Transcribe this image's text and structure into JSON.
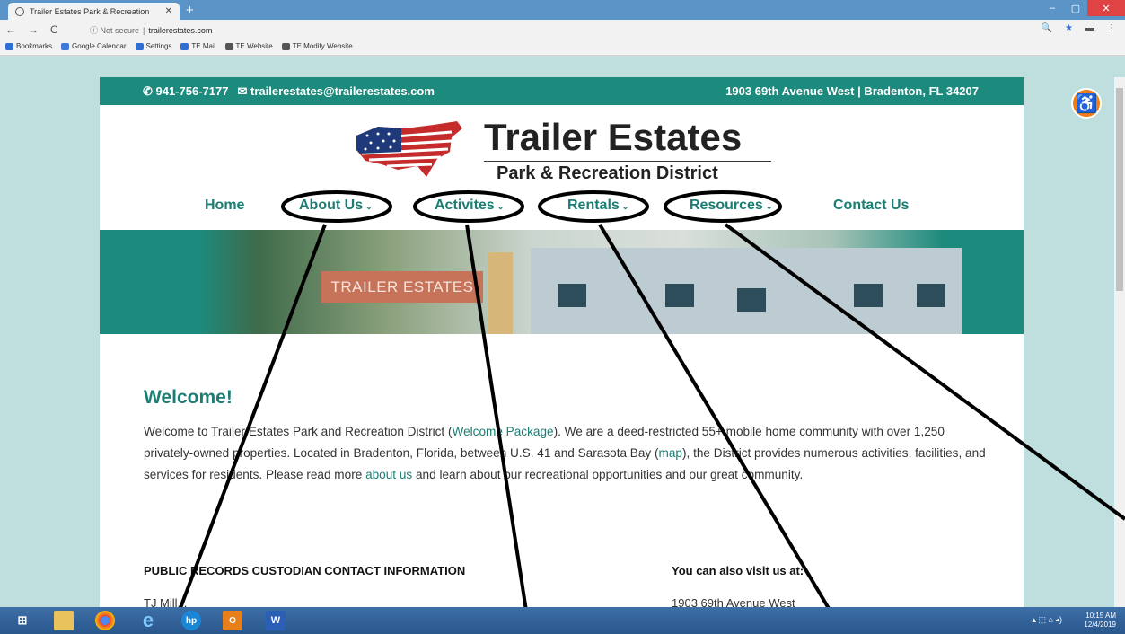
{
  "browser": {
    "tab_title": "Trailer Estates Park & Recreation",
    "tab_close": "✕",
    "new_tab": "+",
    "win_controls": [
      "–",
      "▢",
      "✕"
    ],
    "nav": [
      "←",
      "→",
      "C"
    ],
    "security": "ⓘ Not secure",
    "separator": "|",
    "url": "trailerestates.com",
    "right_icons": [
      "🔍",
      "★",
      "▬",
      "⋮"
    ],
    "bookmarks": [
      {
        "label": "Bookmarks",
        "icon": "star-icon",
        "color": "#2f6fd4"
      },
      {
        "label": "Google Calendar",
        "icon": "calendar-icon",
        "color": "#3f78d8"
      },
      {
        "label": "Settings",
        "icon": "gear-icon",
        "color": "#2f6fd4"
      },
      {
        "label": "TE Mail",
        "icon": "mail-icon",
        "color": "#2f6fd4"
      },
      {
        "label": "TE Website",
        "icon": "globe-icon",
        "color": "#555555"
      },
      {
        "label": "TE Modify Website",
        "icon": "globe-icon",
        "color": "#555555"
      }
    ]
  },
  "site": {
    "phone": "941-756-7177",
    "email": "trailerestates@trailerestates.com",
    "address": "1903 69th Avenue West | Bradenton, FL 34207",
    "logo_title": "Trailer Estates",
    "logo_subtitle": "Park & Recreation District",
    "nav": {
      "home": "Home",
      "about": "About Us",
      "activities": "Activites",
      "rentals": "Rentals",
      "resources": "Resources",
      "contact": "Contact Us"
    },
    "hero_sign": "TRAILER ESTATES",
    "welcome_heading": "Welcome!",
    "intro": {
      "p1": "Welcome to Trailer Estates Park and Recreation District (",
      "link_package": "Welcome Package",
      "p2": "). We are a deed-restricted 55+ mobile home community with over 1,250 privately-owned properties. Located in Bradenton, Florida, between U.S. 41 and Sarasota Bay (",
      "link_map": "map",
      "p3": "), the District provides numerous activities, facilities, and services for residents. Please read more ",
      "link_about": "about us",
      "p4": " and learn about our recreational opportunities and our great community."
    },
    "records_heading": "PUBLIC RECORDS CUSTODIAN CONTACT INFORMATION",
    "visit_heading": "You can also visit us at:",
    "records_name_cut": "TJ Mill...",
    "visit_address_cut": "1903 69th Avenue West"
  },
  "taskbar": {
    "time": "10:15 AM",
    "date": "12/4/2019",
    "tray_icons": "▴ ⬚ ⌂ ◂)"
  },
  "colors": {
    "teal": "#1c8a7d",
    "link": "#1b7d73",
    "accessibility": "#f07c13"
  }
}
